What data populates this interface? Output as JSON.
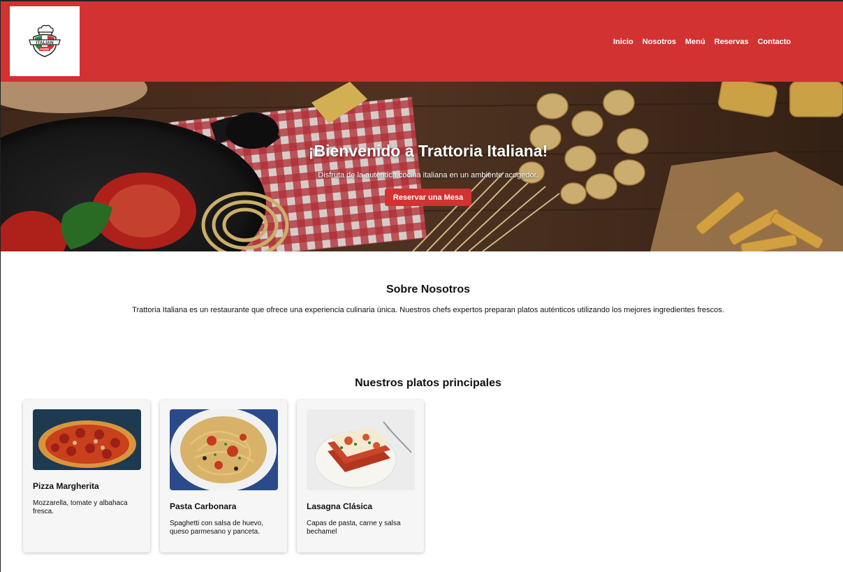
{
  "brand": {
    "logo_text_top": "ITALIAN",
    "logo_text_bottom": "FOOD"
  },
  "nav": {
    "items": [
      "Inicio",
      "Nosotros",
      "Menú",
      "Reservas",
      "Contacto"
    ]
  },
  "hero": {
    "title": "¡Bienvenido a Trattoria Italiana!",
    "subtitle": "Disfruta de la auténtica cocina italiana en un ambiente acogedor.",
    "button": "Reservar una Mesa"
  },
  "about": {
    "title": "Sobre Nosotros",
    "text": "Trattoria Italiana es un restaurante que ofrece una experiencia culinaria única. Nuestros chefs expertos preparan platos auténticos utilizando los mejores ingredientes frescos."
  },
  "dishes": {
    "title": "Nuestros platos principales",
    "items": [
      {
        "name": "Pizza Margherita",
        "description": "Mozzarella, tomate y albahaca fresca."
      },
      {
        "name": "Pasta Carbonara",
        "description": "Spaghetti con salsa de huevo, queso parmesano y panceta."
      },
      {
        "name": "Lasagna Clásica",
        "description": "Capas de pasta, carne y salsa bechamel"
      }
    ]
  },
  "colors": {
    "primary": "#d23232",
    "card_bg": "#f6f6f6"
  }
}
